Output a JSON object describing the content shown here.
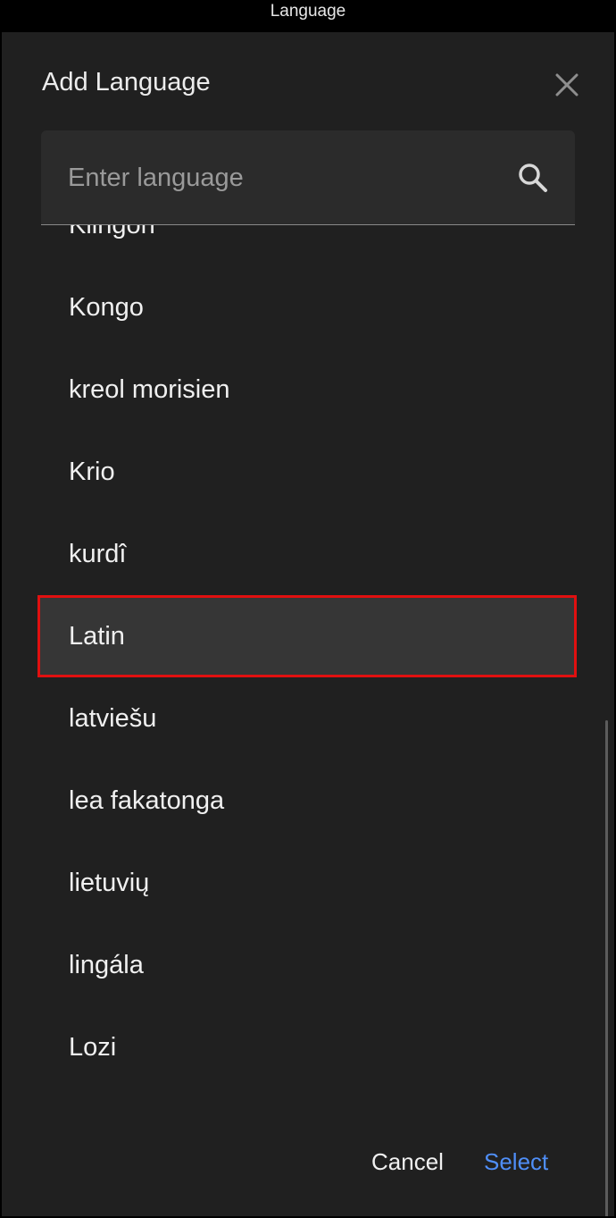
{
  "status": {
    "title": "Language"
  },
  "dialog": {
    "title": "Add Language",
    "search": {
      "placeholder": "Enter language",
      "value": ""
    },
    "languages": [
      {
        "label": "Klingon",
        "selected": false
      },
      {
        "label": "Kongo",
        "selected": false
      },
      {
        "label": "kreol morisien",
        "selected": false
      },
      {
        "label": "Krio",
        "selected": false
      },
      {
        "label": "kurdî",
        "selected": false
      },
      {
        "label": "Latin",
        "selected": true
      },
      {
        "label": "latviešu",
        "selected": false
      },
      {
        "label": "lea fakatonga",
        "selected": false
      },
      {
        "label": "lietuvių",
        "selected": false
      },
      {
        "label": "lingála",
        "selected": false
      },
      {
        "label": "Lozi",
        "selected": false
      }
    ],
    "buttons": {
      "cancel": "Cancel",
      "select": "Select"
    },
    "icons": {
      "close": "close-icon",
      "search": "search-icon"
    },
    "colors": {
      "accent": "#4f8ef7",
      "highlight_border": "#e01010",
      "background": "#202020"
    }
  }
}
